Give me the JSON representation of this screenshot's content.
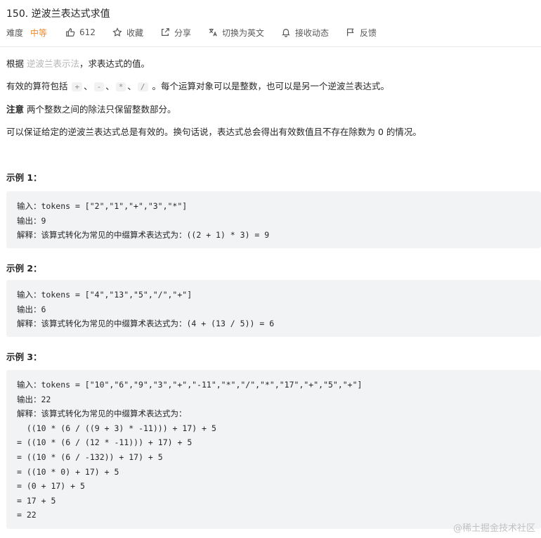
{
  "problem": {
    "title": "150. 逆波兰表达式求值",
    "difficulty_label": "难度",
    "difficulty_value": "中等",
    "likes": "612",
    "actions": {
      "favorite": "收藏",
      "share": "分享",
      "switch_lang": "切换为英文",
      "subscribe": "接收动态",
      "feedback": "反馈"
    }
  },
  "description": {
    "p1_prefix": "根据 ",
    "p1_link": "逆波兰表示法",
    "p1_suffix": "，求表达式的值。",
    "p2_prefix": "有效的算符包括 ",
    "ops": [
      "+",
      "-",
      "*",
      "/"
    ],
    "sep": "、",
    "p2_suffix": " 。每个运算对象可以是整数，也可以是另一个逆波兰表达式。",
    "note_label": "注意",
    "note_text": " 两个整数之间的除法只保留整数部分。",
    "p4": "可以保证给定的逆波兰表达式总是有效的。换句话说，表达式总会得出有效数值且不存在除数为 0 的情况。"
  },
  "examples": [
    {
      "heading": "示例 1：",
      "lines": [
        "输入：tokens = [\"2\",\"1\",\"+\",\"3\",\"*\"]",
        "输出：9",
        "解释：该算式转化为常见的中缀算术表达式为：((2 + 1) * 3) = 9"
      ]
    },
    {
      "heading": "示例 2：",
      "lines": [
        "输入：tokens = [\"4\",\"13\",\"5\",\"/\",\"+\"]",
        "输出：6",
        "解释：该算式转化为常见的中缀算术表达式为：(4 + (13 / 5)) = 6"
      ]
    },
    {
      "heading": "示例 3：",
      "lines": [
        "输入：tokens = [\"10\",\"6\",\"9\",\"3\",\"+\",\"-11\",\"*\",\"/\",\"*\",\"17\",\"+\",\"5\",\"+\"]",
        "输出：22",
        "解释：该算式转化为常见的中缀算术表达式为：",
        "  ((10 * (6 / ((9 + 3) * -11))) + 17) + 5",
        "= ((10 * (6 / (12 * -11))) + 17) + 5",
        "= ((10 * (6 / -132)) + 17) + 5",
        "= ((10 * 0) + 17) + 5",
        "= (0 + 17) + 5",
        "= 17 + 5",
        "= 22"
      ]
    }
  ],
  "watermark": "@稀土掘金技术社区",
  "colors": {
    "difficulty_medium": "#ef8a2e",
    "code_block_bg": "#f2f3f5",
    "link_gray": "#b5b5b5"
  },
  "icons": [
    "thumbs-up-icon",
    "star-icon",
    "share-icon",
    "translate-icon",
    "bell-icon",
    "flag-icon"
  ]
}
